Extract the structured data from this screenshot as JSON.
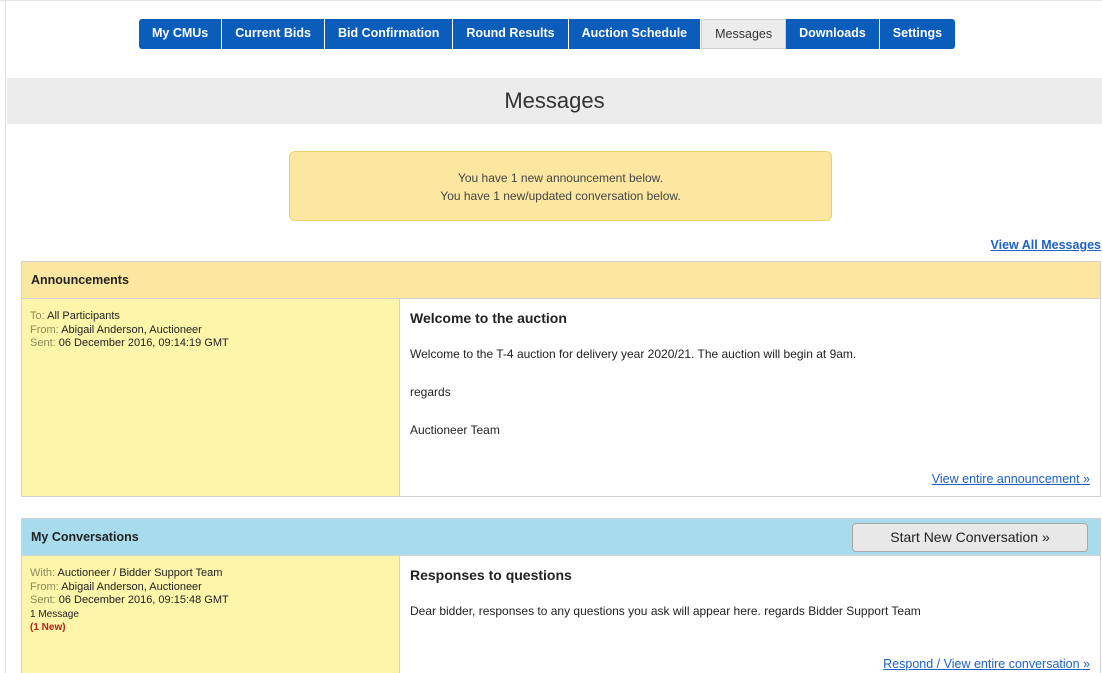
{
  "nav": {
    "items": [
      {
        "label": "My CMUs"
      },
      {
        "label": "Current Bids"
      },
      {
        "label": "Bid Confirmation"
      },
      {
        "label": "Round Results"
      },
      {
        "label": "Auction Schedule"
      },
      {
        "label": "Messages",
        "active": true
      },
      {
        "label": "Downloads"
      },
      {
        "label": "Settings"
      }
    ]
  },
  "page": {
    "title": "Messages"
  },
  "notice": {
    "line1": "You have 1 new announcement below.",
    "line2": "You have 1 new/updated conversation below."
  },
  "view_all_label": "View All Messages",
  "announcements": {
    "header": "Announcements",
    "meta": {
      "to_key": "To:",
      "to": "All Participants",
      "from_key": "From:",
      "from": "Abigail Anderson, Auctioneer",
      "sent_key": "Sent:",
      "sent": "06 December 2016, 09:14:19 GMT"
    },
    "title": "Welcome to the auction",
    "body": [
      "Welcome to the T-4 auction for delivery year 2020/21. The auction will begin at 9am.",
      "regards",
      "Auctioneer Team"
    ],
    "link": "View entire announcement »"
  },
  "conversations": {
    "header": "My Conversations",
    "start_button": "Start New Conversation »",
    "meta": {
      "with_key": "With:",
      "with": "Auctioneer / Bidder Support Team",
      "from_key": "From:",
      "from": "Abigail Anderson, Auctioneer",
      "sent_key": "Sent:",
      "sent": "06 December 2016, 09:15:48 GMT",
      "count": "1 Message",
      "new": "(1 New)"
    },
    "title": "Responses to questions",
    "body": "Dear bidder, responses to any questions you ask will appear here. regards Bidder Support Team",
    "link": "Respond / View entire conversation »"
  },
  "colors": {
    "nav_blue": "#0a5dbb",
    "announce_yellow": "#fce7a1",
    "meta_yellow": "#fdf6aa",
    "conv_blue": "#a8dced",
    "link_blue": "#1f62c4",
    "new_red": "#b8221b"
  }
}
